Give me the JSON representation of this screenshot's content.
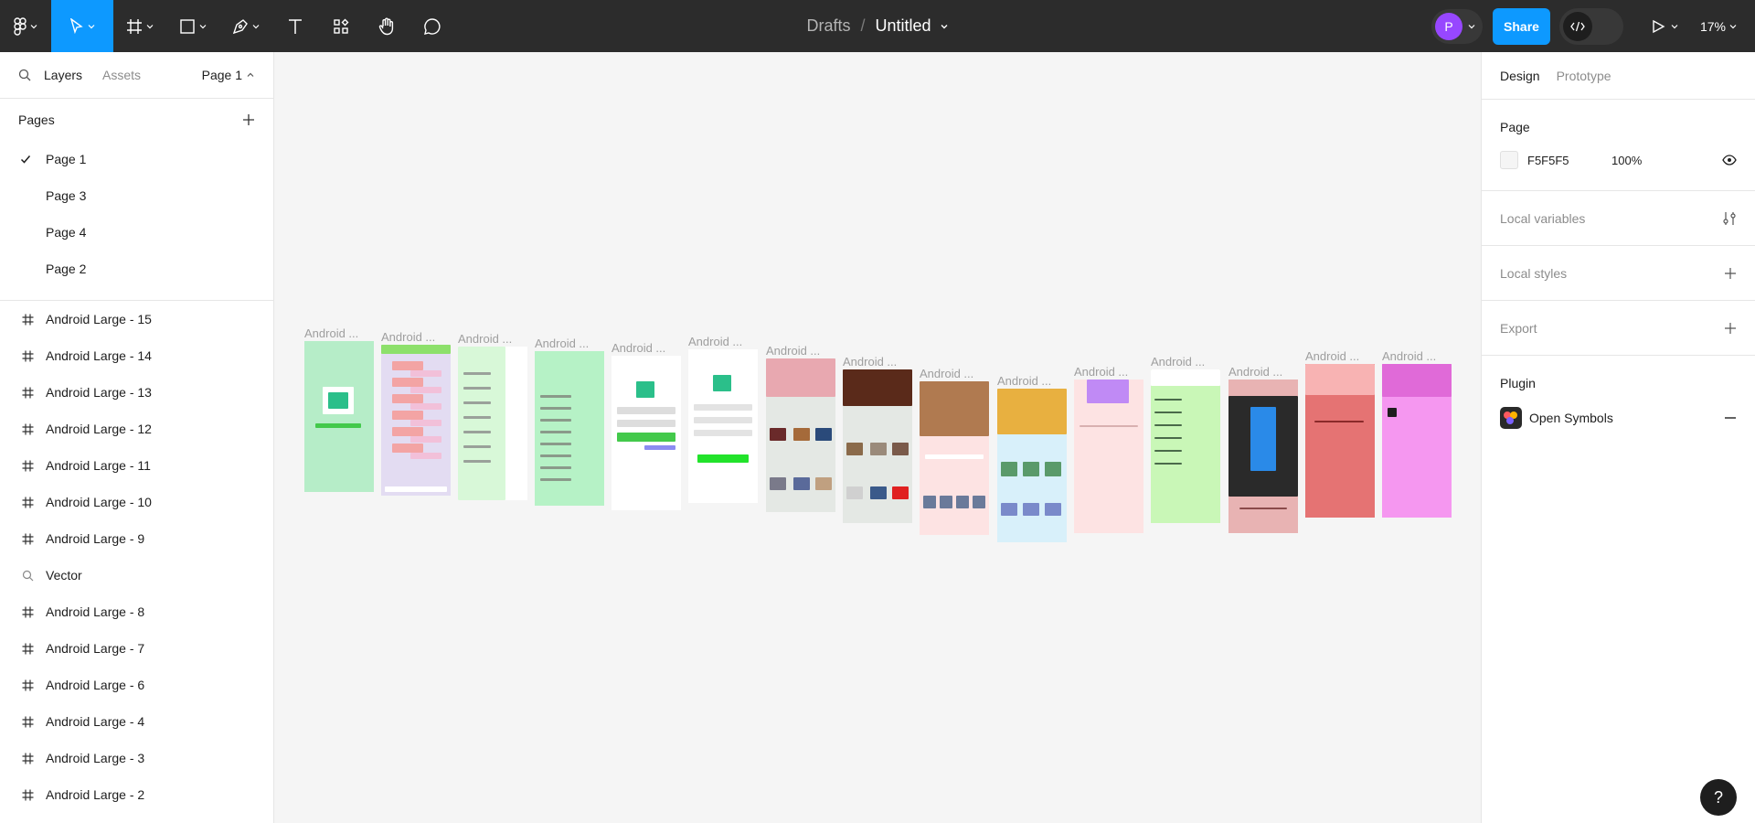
{
  "toolbar": {
    "breadcrumb_drafts": "Drafts",
    "breadcrumb_sep": "/",
    "file_title": "Untitled",
    "avatar_initial": "P",
    "share_label": "Share",
    "zoom_label": "17%"
  },
  "left_panel": {
    "tab_layers": "Layers",
    "tab_assets": "Assets",
    "page_selector": "Page 1",
    "pages_heading": "Pages",
    "pages": [
      "Page 1",
      "Page 3",
      "Page 4",
      "Page 2"
    ],
    "current_page": "Page 1",
    "layers": [
      {
        "name": "Android Large - 15",
        "icon": "frame-icon"
      },
      {
        "name": "Android Large - 14",
        "icon": "frame-icon"
      },
      {
        "name": "Android Large - 13",
        "icon": "frame-icon"
      },
      {
        "name": "Android Large - 12",
        "icon": "frame-icon"
      },
      {
        "name": "Android Large - 11",
        "icon": "frame-icon"
      },
      {
        "name": "Android Large - 10",
        "icon": "frame-icon"
      },
      {
        "name": "Android Large - 9",
        "icon": "frame-icon"
      },
      {
        "name": "Vector",
        "icon": "vector-icon"
      },
      {
        "name": "Android Large - 8",
        "icon": "frame-icon"
      },
      {
        "name": "Android Large - 7",
        "icon": "frame-icon"
      },
      {
        "name": "Android Large - 6",
        "icon": "frame-icon"
      },
      {
        "name": "Android Large - 4",
        "icon": "frame-icon"
      },
      {
        "name": "Android Large - 3",
        "icon": "frame-icon"
      },
      {
        "name": "Android Large - 2",
        "icon": "frame-icon"
      }
    ]
  },
  "canvas": {
    "frame_label": "Android ...",
    "frame_count": 15
  },
  "right_panel": {
    "tab_design": "Design",
    "tab_prototype": "Prototype",
    "page_heading": "Page",
    "page_color": "F5F5F5",
    "page_opacity": "100%",
    "local_variables": "Local variables",
    "local_styles": "Local styles",
    "export": "Export",
    "plugin_heading": "Plugin",
    "plugin_name": "Open Symbols"
  },
  "help_label": "?"
}
